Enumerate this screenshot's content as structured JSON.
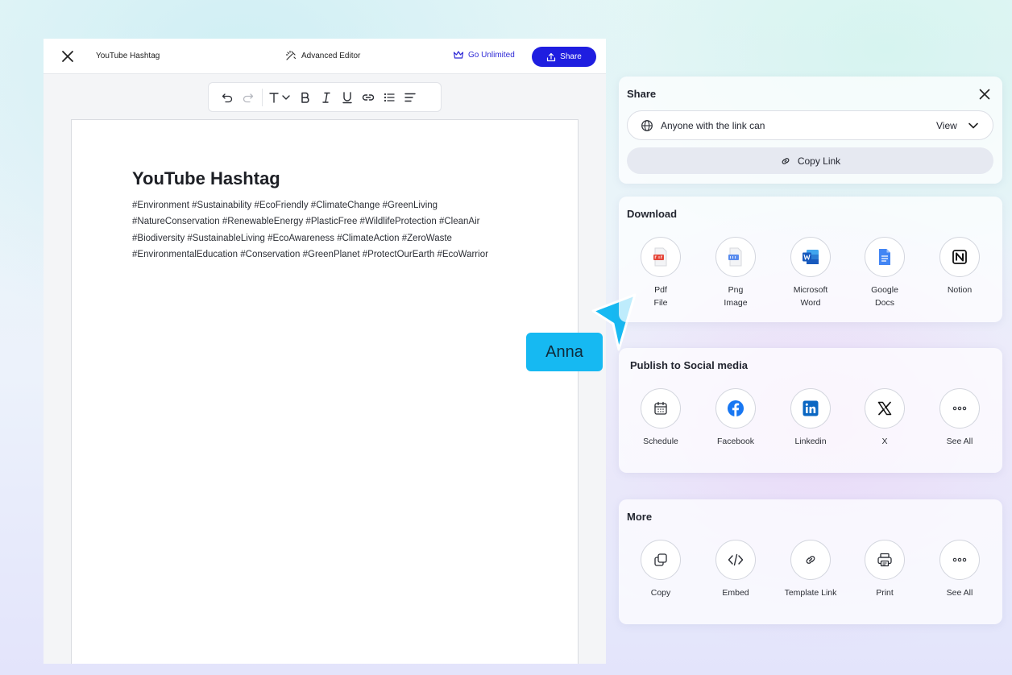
{
  "editor": {
    "doc_title": "YouTube Hashtag",
    "advanced_label": "Advanced Editor",
    "unlimited_label": "Go Unlimited",
    "share_label": "Share"
  },
  "toolbar_icons": [
    "undo-icon",
    "redo-icon",
    "text-style-icon",
    "bold-icon",
    "italic-icon",
    "underline-icon",
    "link-icon",
    "bullet-list-icon",
    "align-icon"
  ],
  "document": {
    "title": "YouTube Hashtag",
    "lines": [
      "#Environment #Sustainability #EcoFriendly #ClimateChange #GreenLiving",
      "#NatureConservation #RenewableEnergy #PlasticFree #WildlifeProtection #CleanAir",
      "#Biodiversity #SustainableLiving #EcoAwareness #ClimateAction #ZeroWaste",
      "#EnvironmentalEducation #Conservation #GreenPlanet #ProtectOurEarth #EcoWarrior"
    ]
  },
  "collaborator": {
    "name": "Anna",
    "color": "#16b9f2"
  },
  "share_panel": {
    "title": "Share",
    "access_text": "Anyone with the link can",
    "access_role": "View",
    "copy_link_label": "Copy Link"
  },
  "download": {
    "title": "Download",
    "items": [
      {
        "label_1": "Pdf",
        "label_2": "File",
        "icon": "pdf-file-icon"
      },
      {
        "label_1": "Png",
        "label_2": "Image",
        "icon": "png-image-icon"
      },
      {
        "label_1": "Microsoft",
        "label_2": "Word",
        "icon": "word-icon"
      },
      {
        "label_1": "Google",
        "label_2": "Docs",
        "icon": "google-docs-icon"
      },
      {
        "label_1": "Notion",
        "label_2": "",
        "icon": "notion-icon"
      }
    ]
  },
  "social": {
    "title": "Publish to Social media",
    "items": [
      {
        "label": "Schedule",
        "icon": "calendar-icon"
      },
      {
        "label": "Facebook",
        "icon": "facebook-icon"
      },
      {
        "label": "Linkedin",
        "icon": "linkedin-icon"
      },
      {
        "label": "X",
        "icon": "x-icon"
      },
      {
        "label": "See All",
        "icon": "more-icon"
      }
    ]
  },
  "more": {
    "title": "More",
    "items": [
      {
        "label": "Copy",
        "icon": "copy-icon"
      },
      {
        "label": "Embed",
        "icon": "embed-icon"
      },
      {
        "label": "Template Link",
        "icon": "link-icon"
      },
      {
        "label": "Print",
        "icon": "printer-icon"
      },
      {
        "label": "See All",
        "icon": "more-icon"
      }
    ]
  },
  "colors": {
    "primary": "#1f1ee0",
    "unlimited": "#2f2ad6",
    "facebook": "#1877f2",
    "linkedin": "#0a66c2",
    "word": "#185abd",
    "google_docs": "#4285f4",
    "pdf": "#e5483b"
  }
}
